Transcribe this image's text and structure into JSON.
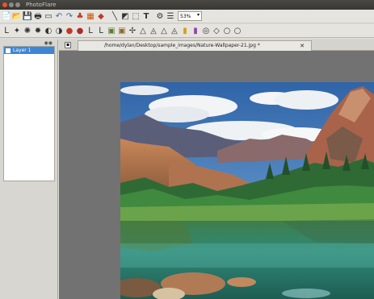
{
  "window": {
    "title": "PhotoFlare",
    "buttons": [
      "close-button",
      "minimize-button",
      "maximize-button"
    ]
  },
  "toolbar1": {
    "icons": [
      "new-file-icon",
      "open-folder-icon",
      "save-icon",
      "print-icon",
      "scanner-icon",
      "undo-icon",
      "redo-icon",
      "color-tools-icon",
      "palette-icon",
      "paint-bucket-icon",
      "line-icon",
      "crop-icon",
      "select-icon",
      "text-icon",
      "settings-icon",
      "layers-icon"
    ],
    "zoom_value": "53%"
  },
  "toolbar2": {
    "icons": [
      "brush-icon",
      "magic-icon",
      "sharpen-icon",
      "blur-icon",
      "grayscale-icon",
      "invert-icon",
      "red-icon",
      "color-balance-icon",
      "flip-h-icon",
      "flip-v-icon",
      "image-icon",
      "filter-icon",
      "move-icon",
      "triangle-1-icon",
      "triangle-2-icon",
      "triangle-3-icon",
      "triangle-4-icon",
      "gradient-icon",
      "color-bars-icon",
      "eye-icon",
      "diamond-icon",
      "circle-1-icon",
      "circle-2-icon"
    ]
  },
  "sidebar": {
    "layer_label": "Layer 1"
  },
  "tab": {
    "path": "/home/dylan/Desktop/sample_images/Nature-Wallpaper-21.jpg *",
    "close_label": "✕"
  },
  "colors": {
    "titlebar": "#3a3834",
    "accent": "#3d86d6",
    "canvas_bg": "#727272"
  }
}
